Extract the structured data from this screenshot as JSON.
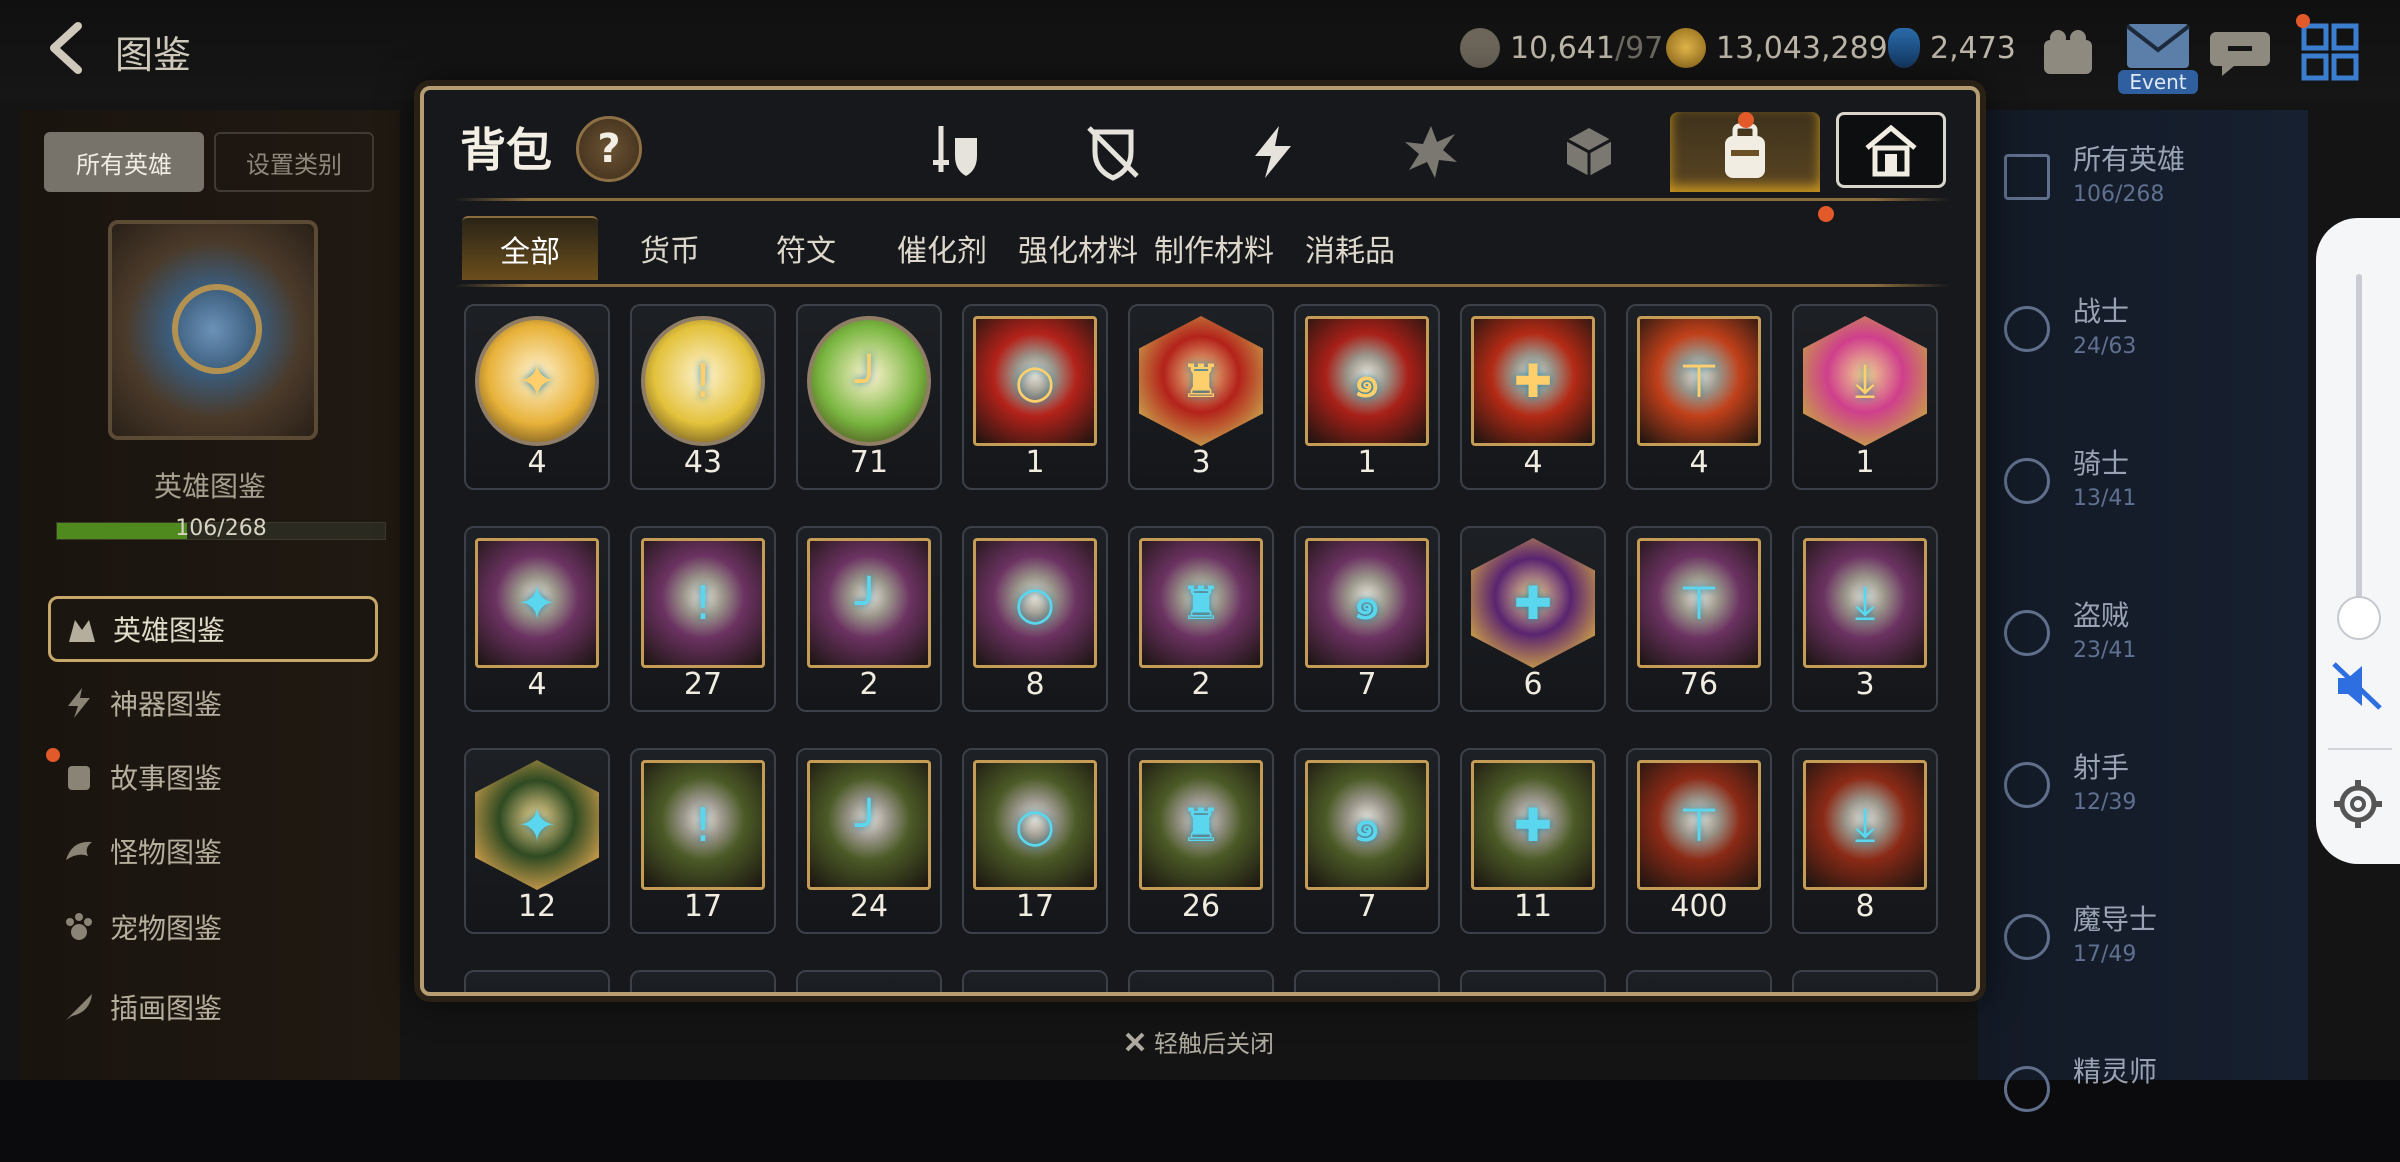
{
  "header": {
    "title": "图鉴",
    "stamina_value": "10,641",
    "stamina_max": "/97",
    "gold": "13,043,289",
    "crystals": "2,473",
    "event_label": "Event"
  },
  "left_panel": {
    "tabs": [
      "所有英雄",
      "设置类别"
    ],
    "book_title": "英雄图鉴",
    "book_progress": "106/268",
    "book_progress_fraction": 0.395,
    "menu": [
      "英雄图鉴",
      "神器图鉴",
      "故事图鉴",
      "怪物图鉴",
      "宠物图鉴",
      "插画图鉴"
    ]
  },
  "right_panel": {
    "classes": [
      {
        "name": "所有英雄",
        "count": "106/268",
        "icon": "all-icon"
      },
      {
        "name": "战士",
        "count": "24/63",
        "icon": "sword-icon"
      },
      {
        "name": "骑士",
        "count": "13/41",
        "icon": "shield-icon"
      },
      {
        "name": "盗贼",
        "count": "23/41",
        "icon": "hood-icon"
      },
      {
        "name": "射手",
        "count": "12/39",
        "icon": "bow-icon"
      },
      {
        "name": "魔导士",
        "count": "17/49",
        "icon": "wizard-icon"
      },
      {
        "name": "精灵师",
        "count": "",
        "icon": "spirit-icon"
      }
    ]
  },
  "modal": {
    "title": "背包",
    "help": "?",
    "category_icons": [
      "weapon-icon",
      "armor-icon",
      "lightning-icon",
      "splash-icon",
      "dice-icon",
      "bag-icon",
      "house-icon"
    ],
    "sub_tabs": [
      "全部",
      "货币",
      "符文",
      "催化剂",
      "强化材料",
      "制作材料",
      "消耗品"
    ],
    "items": [
      {
        "type": "round",
        "color": "#e8b23a",
        "qty": "4"
      },
      {
        "type": "round",
        "color": "#e3c23c",
        "qty": "43"
      },
      {
        "type": "round",
        "color": "#79b640",
        "qty": "71"
      },
      {
        "type": "square",
        "color": "#b3221a",
        "qty": "1"
      },
      {
        "type": "hex",
        "color": "#b3221a",
        "qty": "3"
      },
      {
        "type": "square",
        "color": "#a82018",
        "qty": "1"
      },
      {
        "type": "square",
        "color": "#b32a15",
        "qty": "4"
      },
      {
        "type": "square",
        "color": "#c0401a",
        "qty": "4"
      },
      {
        "type": "hex",
        "color": "#cf3f8c",
        "qty": "1"
      },
      {
        "type": "square",
        "color": "#6b3261",
        "qty": "4"
      },
      {
        "type": "square",
        "color": "#6b3261",
        "qty": "27"
      },
      {
        "type": "square",
        "color": "#6b3261",
        "qty": "2"
      },
      {
        "type": "square",
        "color": "#6b3261",
        "qty": "8"
      },
      {
        "type": "square",
        "color": "#6b3261",
        "qty": "2"
      },
      {
        "type": "square",
        "color": "#6b3261",
        "qty": "7"
      },
      {
        "type": "hex",
        "color": "#5a2470",
        "qty": "6"
      },
      {
        "type": "square",
        "color": "#6b3261",
        "qty": "76"
      },
      {
        "type": "square",
        "color": "#6b3261",
        "qty": "3"
      },
      {
        "type": "hex",
        "color": "#2f4a22",
        "qty": "12"
      },
      {
        "type": "square",
        "color": "#4b5a26",
        "qty": "17"
      },
      {
        "type": "square",
        "color": "#4b5a26",
        "qty": "24"
      },
      {
        "type": "square",
        "color": "#4b5a26",
        "qty": "17"
      },
      {
        "type": "square",
        "color": "#4b5a26",
        "qty": "26"
      },
      {
        "type": "square",
        "color": "#4b5a26",
        "qty": "7"
      },
      {
        "type": "square",
        "color": "#4b5a26",
        "qty": "11"
      },
      {
        "type": "square",
        "color": "#8b2a16",
        "qty": "400"
      },
      {
        "type": "square",
        "color": "#8b2a16",
        "qty": "8"
      }
    ]
  },
  "close_hint": "轻触后关闭"
}
